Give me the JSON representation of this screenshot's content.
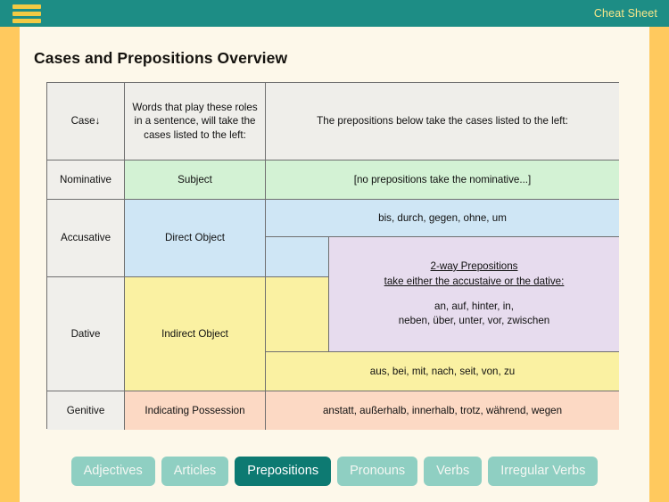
{
  "topbar": {
    "menu_icon": "hamburger-menu-icon",
    "right_label": "Cheat Sheet"
  },
  "page": {
    "title": "Cases and Prepositions Overview"
  },
  "table": {
    "header": {
      "case": "Case↓",
      "roles": "Words that play these roles in a sentence, will take the cases listed to the left:",
      "prepositions": "The prepositions below take the cases listed to the left:"
    },
    "rows": {
      "nominative": {
        "case": "Nominative",
        "role": "Subject",
        "prepositions": "[no prepositions take the nominative...]"
      },
      "accusative": {
        "case": "Accusative",
        "role": "Direct Object",
        "prepositions": "bis, durch, gegen, ohne, um"
      },
      "dative": {
        "case": "Dative",
        "role": "Indirect Object",
        "prepositions": "aus, bei, mit, nach, seit, von, zu"
      },
      "genitive": {
        "case": "Genitive",
        "role": "Indicating Possession",
        "prepositions": "anstatt, außerhalb, innerhalb, trotz, während, wegen"
      }
    },
    "twoway": {
      "title": "2-way Prepositions ",
      "subtitle": "take either the accustaive or the dative:",
      "line1": "an, auf, hinter, in,",
      "line2": "neben, über, unter, vor, zwischen"
    }
  },
  "nav": {
    "buttons": [
      {
        "label": "Adjectives",
        "active": false
      },
      {
        "label": "Articles",
        "active": false
      },
      {
        "label": "Prepositions",
        "active": true
      },
      {
        "label": "Pronouns",
        "active": false
      },
      {
        "label": "Verbs",
        "active": false
      },
      {
        "label": "Irregular Verbs",
        "active": false
      }
    ]
  },
  "colors": {
    "teal": "#1d8d85",
    "teal_dark": "#0d7a72",
    "teal_light": "#8fcfc2",
    "gold": "#ffc95e",
    "gold_icon": "#f2ca44",
    "cream": "#fdf8ea",
    "nominative": "#d3f2d4",
    "accusative": "#cfe6f5",
    "dative": "#faf1a2",
    "genitive": "#fcd9c4",
    "twoway": "#e7dcee",
    "header_grey": "#efeeea"
  }
}
